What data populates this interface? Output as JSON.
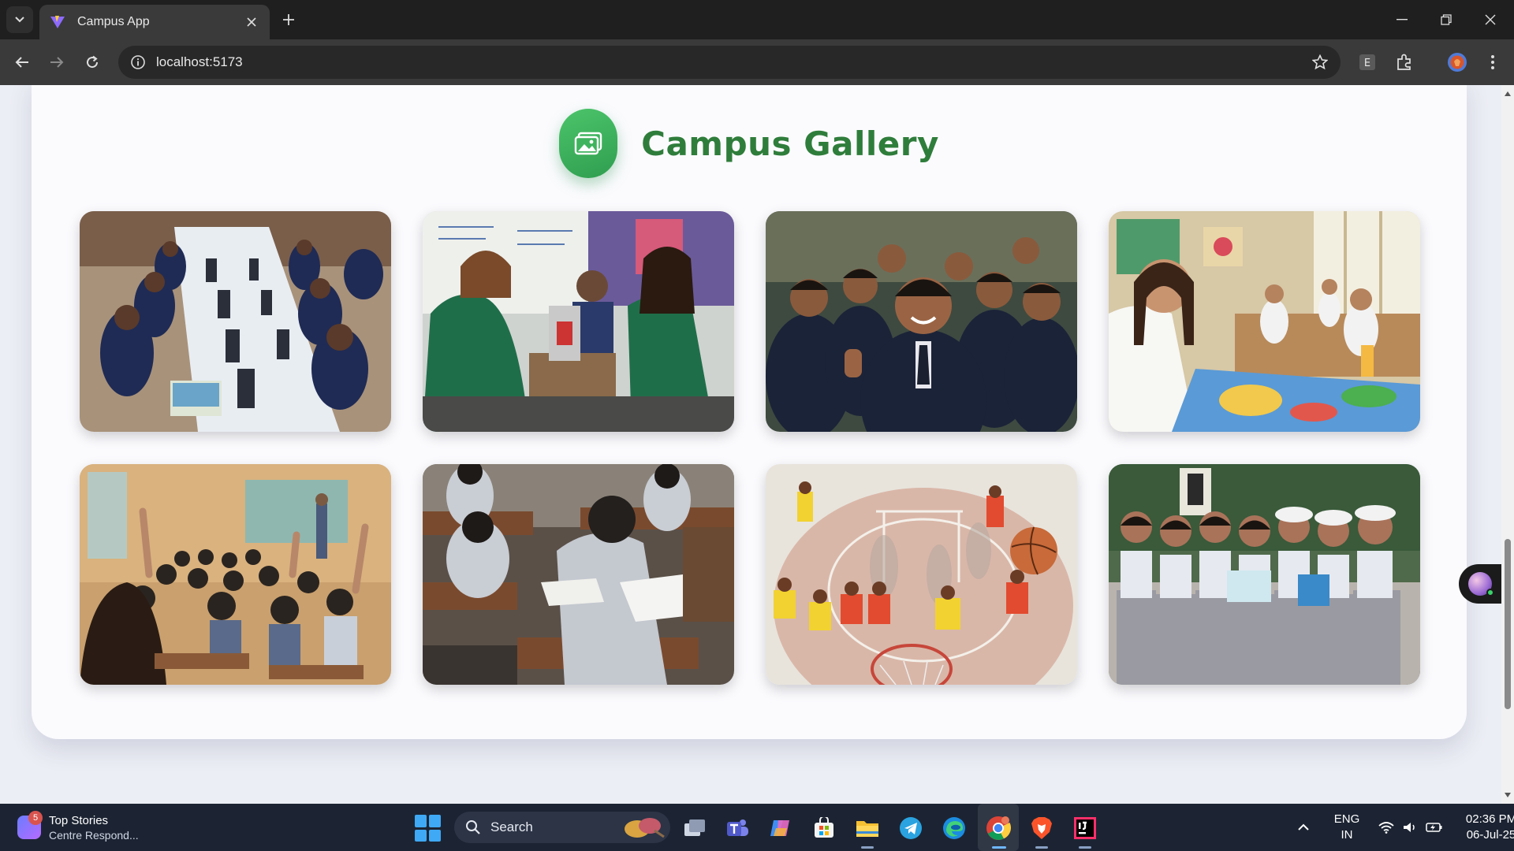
{
  "browser": {
    "tab_title": "Campus App",
    "url": "localhost:5173",
    "profile_initial": "E"
  },
  "page": {
    "gallery_title": "Campus Gallery",
    "accent_color": "#2f7d3b",
    "badge_color": "#3fb35e",
    "photos": [
      {
        "subject": "computer-lab"
      },
      {
        "subject": "science-lab"
      },
      {
        "subject": "students-thumbs-up"
      },
      {
        "subject": "art-class"
      },
      {
        "subject": "classroom-hands-raised"
      },
      {
        "subject": "exam-hall"
      },
      {
        "subject": "basketball-court"
      },
      {
        "subject": "students-group"
      }
    ]
  },
  "taskbar": {
    "news_badge": "5",
    "news_title": "Top Stories",
    "news_subtitle": "Centre Respond...",
    "search_label": "Search",
    "language": "ENG",
    "region": "IN",
    "time": "02:36 PM",
    "date": "06-Jul-25"
  }
}
